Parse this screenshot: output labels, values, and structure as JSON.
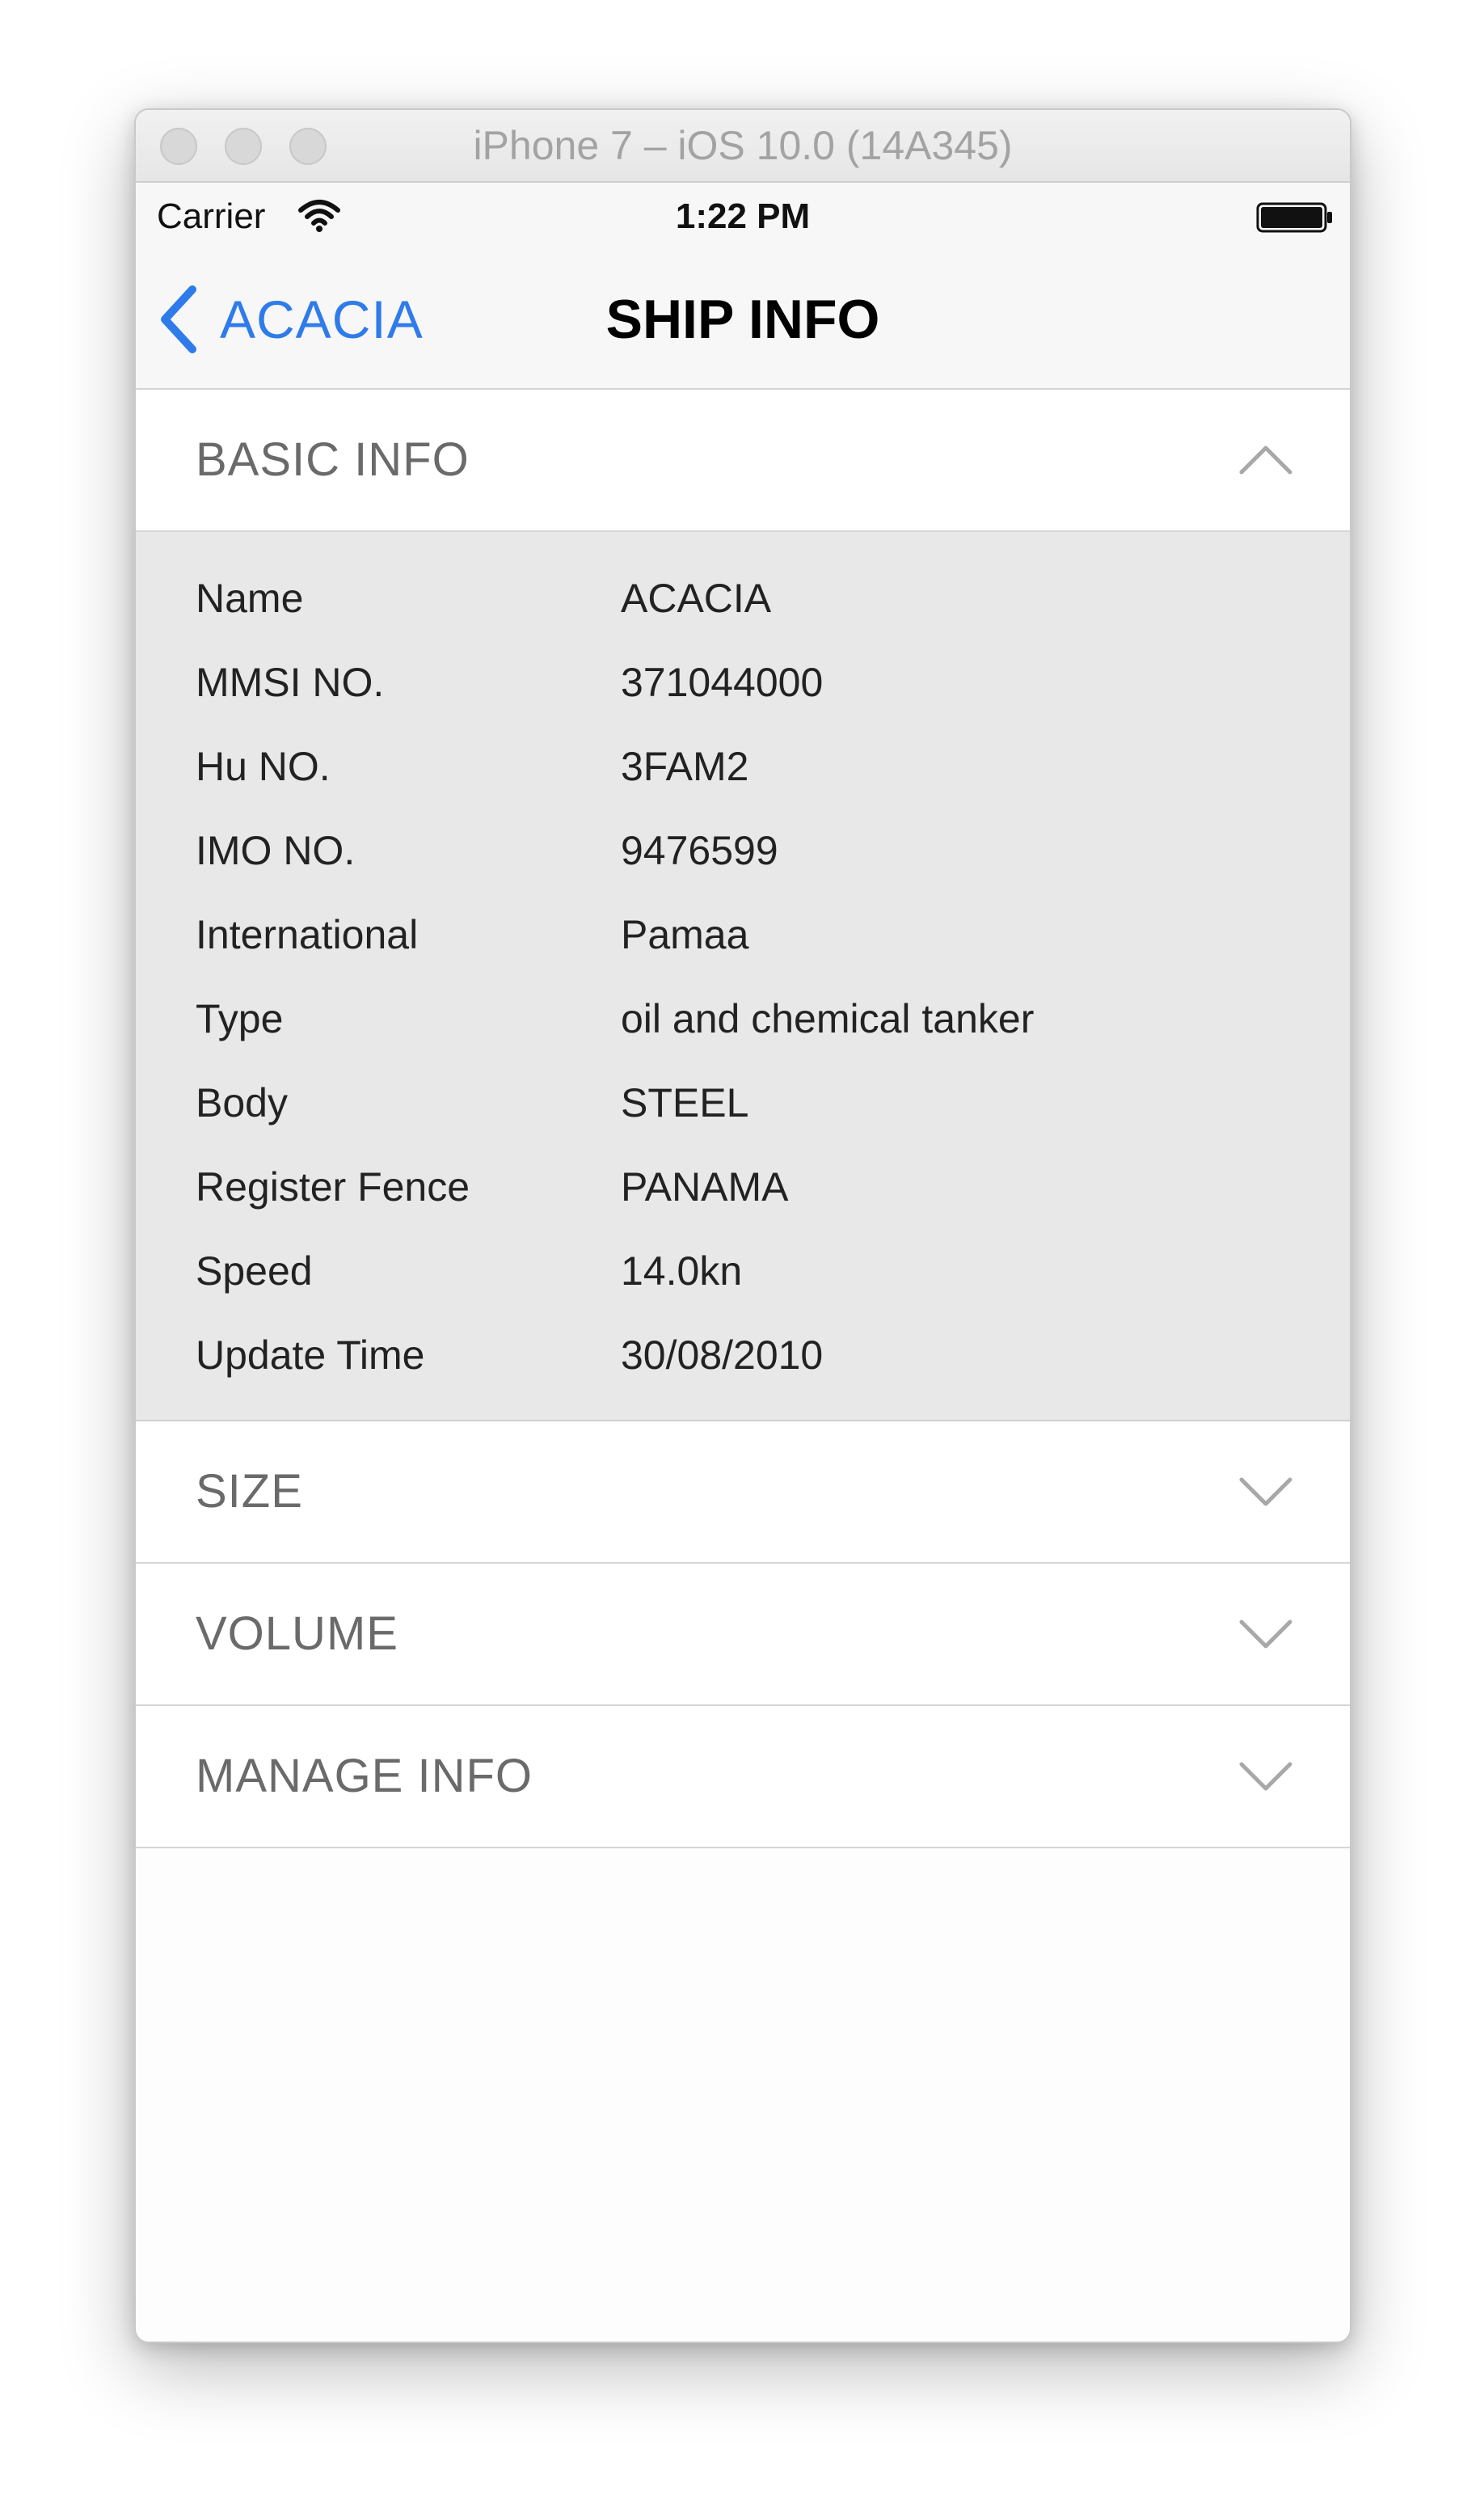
{
  "window": {
    "title": "iPhone 7 – iOS 10.0 (14A345)"
  },
  "status_bar": {
    "carrier": "Carrier",
    "time": "1:22 PM",
    "icons": [
      "wifi-icon",
      "battery-icon"
    ]
  },
  "nav": {
    "back_label": "ACACIA",
    "title": "SHIP INFO",
    "accent_color": "#2f7bea"
  },
  "sections": {
    "basic": {
      "title": "BASIC INFO",
      "expanded": true,
      "icon": "chevron-up-icon",
      "rows": [
        {
          "label": "Name",
          "value": "ACACIA"
        },
        {
          "label": "MMSI NO.",
          "value": "371044000"
        },
        {
          "label": "Hu NO.",
          "value": "3FAM2"
        },
        {
          "label": "IMO NO.",
          "value": "9476599"
        },
        {
          "label": "International",
          "value": "Pamaa"
        },
        {
          "label": "Type",
          "value": "oil and chemical tanker"
        },
        {
          "label": "Body",
          "value": "STEEL"
        },
        {
          "label": "Register Fence",
          "value": "PANAMA"
        },
        {
          "label": "Speed",
          "value": "14.0kn"
        },
        {
          "label": "Update Time",
          "value": "30/08/2010"
        }
      ]
    },
    "size": {
      "title": "SIZE",
      "expanded": false,
      "icon": "chevron-down-icon"
    },
    "volume": {
      "title": "VOLUME",
      "expanded": false,
      "icon": "chevron-down-icon"
    },
    "manage": {
      "title": "MANAGE INFO",
      "expanded": false,
      "icon": "chevron-down-icon"
    }
  }
}
